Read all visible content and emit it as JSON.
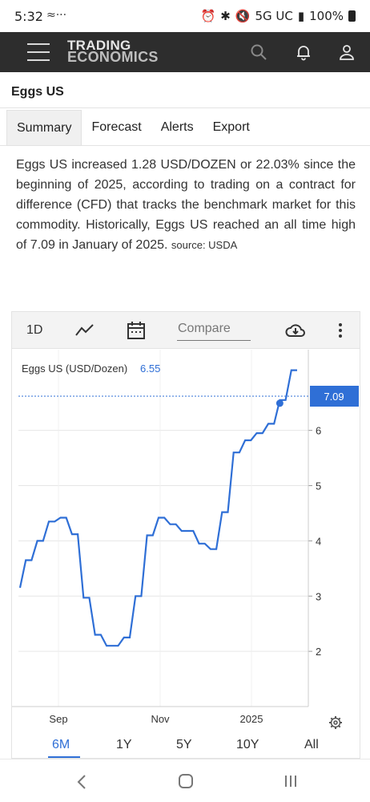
{
  "status": {
    "time": "5:32",
    "network": "5G UC",
    "battery": "100%"
  },
  "header": {
    "logo_line1": "TRADING",
    "logo_line2": "ECONOMICS"
  },
  "page": {
    "title": "Eggs US"
  },
  "tabs": [
    {
      "label": "Summary",
      "active": true
    },
    {
      "label": "Forecast",
      "active": false
    },
    {
      "label": "Alerts",
      "active": false
    },
    {
      "label": "Export",
      "active": false
    }
  ],
  "summary": {
    "text": "Eggs US increased 1.28 USD/DOZEN or 22.03% since the beginning of 2025, according to trading on a contract for difference (CFD) that tracks the benchmark market for this commodity. Historically, Eggs US reached an all time high of 7.09 in January of 2025.",
    "source": "source: USDA"
  },
  "toolbar": {
    "interval": "1D",
    "compare_placeholder": "Compare"
  },
  "chart_data": {
    "type": "line",
    "legend_label": "Eggs US (USD/Dozen)",
    "legend_value": "6.55",
    "last_value_label": "7.09",
    "accent_color": "#2f6fd6",
    "x_ticks": [
      "Sep",
      "Nov",
      "2025"
    ],
    "y_ticks": [
      "2",
      "3",
      "4",
      "5",
      "6"
    ],
    "ylim": [
      1,
      7.2
    ],
    "grid": "horizontal",
    "series": [
      {
        "values": [
          3.15,
          3.65,
          3.65,
          4.0,
          4.0,
          4.35,
          4.35,
          4.42,
          4.42,
          4.12,
          4.12,
          2.97,
          2.97,
          2.3,
          2.3,
          2.1,
          2.1,
          2.1,
          2.25,
          2.25,
          3.0,
          3.0,
          4.1,
          4.1,
          4.42,
          4.42,
          4.3,
          4.3,
          4.18,
          4.18,
          4.18,
          3.95,
          3.95,
          3.85,
          3.85,
          4.52,
          4.52,
          5.6,
          5.6,
          5.82,
          5.82,
          5.95,
          5.95,
          6.12,
          6.12,
          6.55,
          6.55,
          7.09,
          7.09
        ],
        "marker_value": 6.55
      }
    ]
  },
  "ranges": [
    {
      "label": "6M",
      "active": true
    },
    {
      "label": "1Y",
      "active": false
    },
    {
      "label": "5Y",
      "active": false
    },
    {
      "label": "10Y",
      "active": false
    },
    {
      "label": "All",
      "active": false
    }
  ]
}
